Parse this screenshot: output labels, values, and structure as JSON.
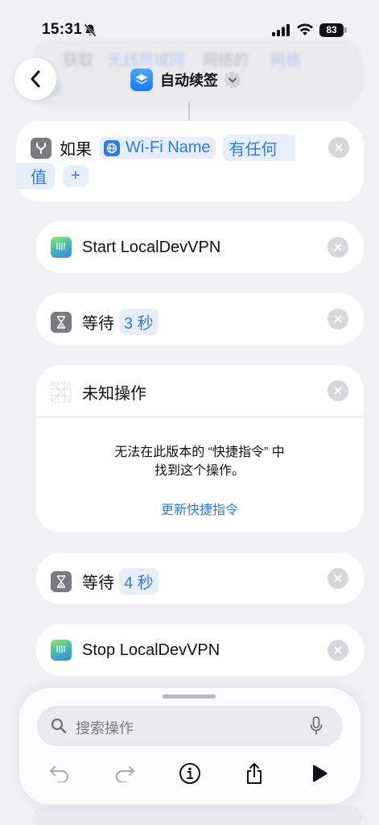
{
  "status": {
    "time": "15:31",
    "battery": "83"
  },
  "background_action": {
    "parts": [
      "获取",
      "无线局域网",
      "网络的",
      "网络",
      "标"
    ]
  },
  "nav": {
    "title": "自动续签"
  },
  "if_block": {
    "keyword": "如果",
    "param": "Wi-Fi Name",
    "condition": "有任何值",
    "condition_line1": "有任何",
    "condition_line2": "值",
    "add": "+"
  },
  "actions": [
    {
      "label": "Start LocalDevVPN"
    },
    {
      "label": "等待",
      "value": "3 秒"
    },
    {
      "label": "未知操作",
      "message_line1": "无法在此版本的 “快捷指令” 中",
      "message_line2": "找到这个操作。",
      "link": "更新快捷指令"
    },
    {
      "label": "等待",
      "value": "4 秒"
    },
    {
      "label": "Stop LocalDevVPN"
    }
  ],
  "dock": {
    "search_placeholder": "搜索操作"
  },
  "colors": {
    "accent": "#2f7ae5",
    "background": "#f0f0f5",
    "card": "#ffffff"
  }
}
